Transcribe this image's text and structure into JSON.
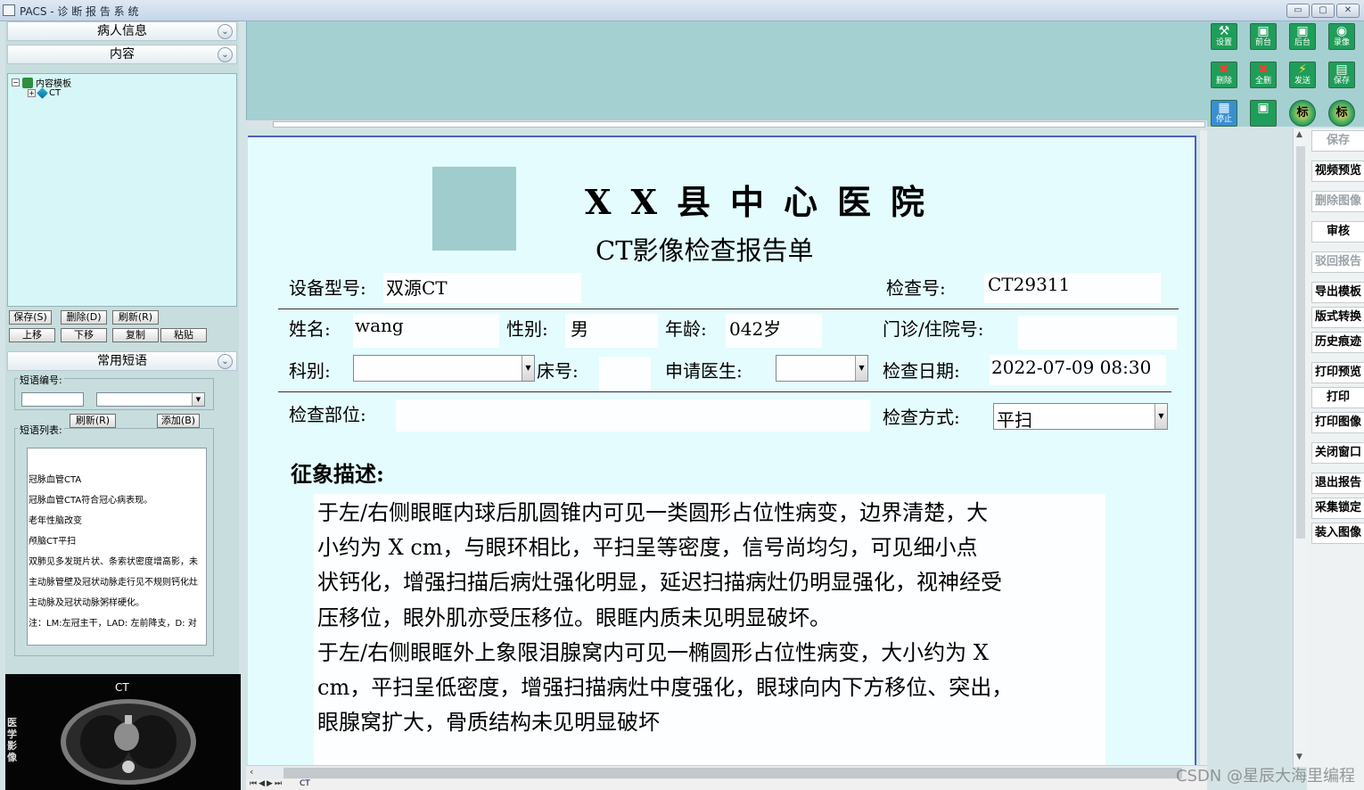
{
  "window": {
    "title": "PACS - 诊 断 报 告 系 统",
    "buttons": [
      "▭",
      "▢",
      "✕"
    ]
  },
  "left": {
    "panels": {
      "patient_info": "病人信息",
      "content": "内容",
      "common_phrases": "常用短语"
    },
    "tree": {
      "root": "内容模板",
      "child": "CT",
      "root_toggle": "−",
      "child_toggle": "+"
    },
    "buttons": {
      "save": "保存(S)",
      "delete": "删除(D)",
      "refresh": "刷新(R)",
      "move_up": "上移",
      "move_down": "下移",
      "copy": "复制",
      "paste": "粘贴"
    },
    "phrase": {
      "code_label": "短语编号:",
      "list_label": "短语列表:",
      "refresh_button": "刷新(R)",
      "add_button": "添加(B)",
      "items": [
        "冠脉血管CTA",
        "冠脉血管CTA符合冠心病表现。",
        "老年性脑改变",
        "颅脑CT平扫",
        "双肺见多发斑片状、条索状密度增高影，未",
        "主动脉管壁及冠状动脉走行见不规则钙化灶",
        "主动脉及冠状动脉粥样硬化。",
        "注：LM:左冠主干，LAD: 左前降支，D: 对"
      ]
    },
    "thumbnail": {
      "label": "CT",
      "side_text": "医学影像"
    }
  },
  "report": {
    "hospital": "XX县中心医院",
    "title": "CT影像检查报告单",
    "fields": {
      "device_label": "设备型号:",
      "device_value": "双源CT",
      "exam_no_label": "检查号:",
      "exam_no_value": "CT29311",
      "name_label": "姓名:",
      "name_value": "wang",
      "sex_label": "性别:",
      "sex_value": "男",
      "age_label": "年龄:",
      "age_value": "042岁",
      "outpatient_label": "门诊/住院号:",
      "outpatient_value": "",
      "dept_label": "科别:",
      "dept_value": "",
      "bed_label": "床号:",
      "bed_value": "",
      "doctor_label": "申请医生:",
      "doctor_value": "",
      "exam_date_label": "检查日期:",
      "exam_date_value": "2022-07-09 08:30",
      "exam_part_label": "检查部位:",
      "exam_part_value": "",
      "exam_method_label": "检查方式:",
      "exam_method_value": "平扫"
    },
    "findings_title": "征象描述:",
    "findings_lines": [
      "于左/右侧眼眶内球后肌圆锥内可见一类圆形占位性病变，边界清楚，大",
      "小约为  X  cm，与眼环相比，平扫呈等密度，信号尚均匀，可见细小点",
      "状钙化，增强扫描后病灶强化明显，延迟扫描病灶仍明显强化，视神经受",
      "压移位，眼外肌亦受压移位。眼眶内质未见明显破坏。",
      "于左/右侧眼眶外上象限泪腺窝内可见一椭圆形占位性病变，大小约为  X",
      "cm，平扫呈低密度，增强扫描病灶中度强化，眼球向内下方移位、突出，",
      "眼腺窝扩大，骨质结构未见明显破坏"
    ]
  },
  "sheet_tab": "CT",
  "toolbar": [
    {
      "label": "设置",
      "icon": "settings-icon"
    },
    {
      "label": "前台",
      "icon": "film-icon"
    },
    {
      "label": "后台",
      "icon": "film-icon"
    },
    {
      "label": "录像",
      "icon": "camera-icon"
    },
    {
      "label": "删除",
      "icon": "delete-icon"
    },
    {
      "label": "全删",
      "icon": "delete-all-icon"
    },
    {
      "label": "发送",
      "icon": "lightning-icon"
    },
    {
      "label": "保存",
      "icon": "floppy-icon"
    },
    {
      "label": "停止",
      "icon": "grid-icon"
    },
    {
      "label": "",
      "icon": "capture-icon"
    },
    {
      "label": "标",
      "icon": "mark-icon"
    },
    {
      "label": "标",
      "icon": "mark-cancel-icon"
    }
  ],
  "right_buttons": [
    {
      "label": "保存",
      "disabled": true
    },
    {
      "label": "视频预览",
      "disabled": false
    },
    {
      "label": "删除图像",
      "disabled": true
    },
    {
      "label": "审核",
      "disabled": false
    },
    {
      "label": "驳回报告",
      "disabled": true
    },
    {
      "label": "导出模板",
      "disabled": false
    },
    {
      "label": "版式转换",
      "disabled": false
    },
    {
      "label": "历史痕迹",
      "disabled": false
    },
    {
      "label": "打印预览",
      "disabled": false
    },
    {
      "label": "打印",
      "disabled": false
    },
    {
      "label": "打印图像",
      "disabled": false
    },
    {
      "label": "关闭窗口",
      "disabled": false
    },
    {
      "label": "退出报告",
      "disabled": false
    },
    {
      "label": "采集锁定",
      "disabled": false
    },
    {
      "label": "装入图像",
      "disabled": false
    }
  ],
  "watermark": "CSDN @星辰大海里编程",
  "colors": {
    "paper": "#e4fcfd",
    "header_band": "#a5d0d2",
    "panel": "#c7ddde",
    "paper_border": "#4c62b8"
  }
}
